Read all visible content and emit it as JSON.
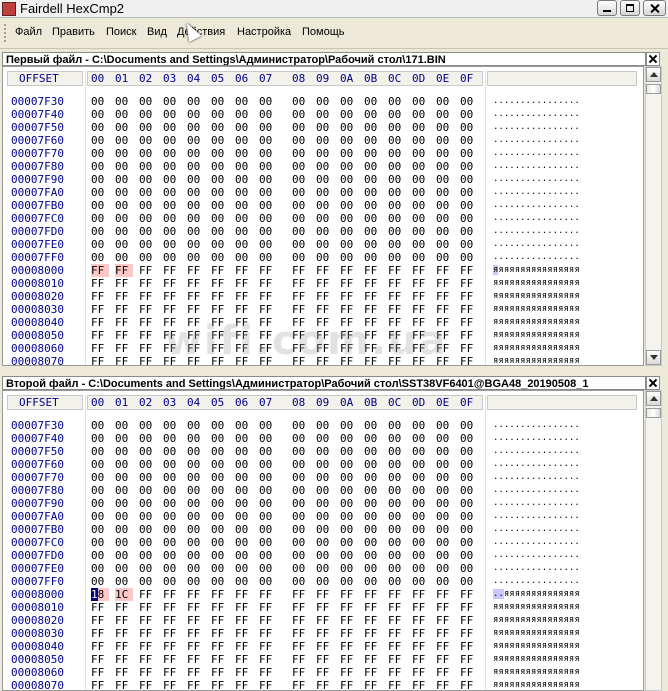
{
  "window": {
    "title": "Fairdell HexCmp2"
  },
  "menu": [
    "Файл",
    "Править",
    "Поиск",
    "Вид",
    "Действия",
    "Настройка",
    "Помощь"
  ],
  "columns": [
    "00",
    "01",
    "02",
    "03",
    "04",
    "05",
    "06",
    "07",
    "08",
    "09",
    "0A",
    "0B",
    "0C",
    "0D",
    "0E",
    "0F"
  ],
  "offset_label": "OFFSET",
  "watermark": "wifi.com.ua",
  "pane1": {
    "header": "Первый файл - C:\\Documents and Settings\\Администратор\\Рабочий стол\\171.BIN",
    "rows": [
      {
        "offset": "00007F30",
        "bytes": [
          "00",
          "00",
          "00",
          "00",
          "00",
          "00",
          "00",
          "00",
          "00",
          "00",
          "00",
          "00",
          "00",
          "00",
          "00",
          "00"
        ],
        "ascii": "................"
      },
      {
        "offset": "00007F40",
        "bytes": [
          "00",
          "00",
          "00",
          "00",
          "00",
          "00",
          "00",
          "00",
          "00",
          "00",
          "00",
          "00",
          "00",
          "00",
          "00",
          "00"
        ],
        "ascii": "................"
      },
      {
        "offset": "00007F50",
        "bytes": [
          "00",
          "00",
          "00",
          "00",
          "00",
          "00",
          "00",
          "00",
          "00",
          "00",
          "00",
          "00",
          "00",
          "00",
          "00",
          "00"
        ],
        "ascii": "................"
      },
      {
        "offset": "00007F60",
        "bytes": [
          "00",
          "00",
          "00",
          "00",
          "00",
          "00",
          "00",
          "00",
          "00",
          "00",
          "00",
          "00",
          "00",
          "00",
          "00",
          "00"
        ],
        "ascii": "................"
      },
      {
        "offset": "00007F70",
        "bytes": [
          "00",
          "00",
          "00",
          "00",
          "00",
          "00",
          "00",
          "00",
          "00",
          "00",
          "00",
          "00",
          "00",
          "00",
          "00",
          "00"
        ],
        "ascii": "................"
      },
      {
        "offset": "00007F80",
        "bytes": [
          "00",
          "00",
          "00",
          "00",
          "00",
          "00",
          "00",
          "00",
          "00",
          "00",
          "00",
          "00",
          "00",
          "00",
          "00",
          "00"
        ],
        "ascii": "................"
      },
      {
        "offset": "00007F90",
        "bytes": [
          "00",
          "00",
          "00",
          "00",
          "00",
          "00",
          "00",
          "00",
          "00",
          "00",
          "00",
          "00",
          "00",
          "00",
          "00",
          "00"
        ],
        "ascii": "................"
      },
      {
        "offset": "00007FA0",
        "bytes": [
          "00",
          "00",
          "00",
          "00",
          "00",
          "00",
          "00",
          "00",
          "00",
          "00",
          "00",
          "00",
          "00",
          "00",
          "00",
          "00"
        ],
        "ascii": "................"
      },
      {
        "offset": "00007FB0",
        "bytes": [
          "00",
          "00",
          "00",
          "00",
          "00",
          "00",
          "00",
          "00",
          "00",
          "00",
          "00",
          "00",
          "00",
          "00",
          "00",
          "00"
        ],
        "ascii": "................"
      },
      {
        "offset": "00007FC0",
        "bytes": [
          "00",
          "00",
          "00",
          "00",
          "00",
          "00",
          "00",
          "00",
          "00",
          "00",
          "00",
          "00",
          "00",
          "00",
          "00",
          "00"
        ],
        "ascii": "................"
      },
      {
        "offset": "00007FD0",
        "bytes": [
          "00",
          "00",
          "00",
          "00",
          "00",
          "00",
          "00",
          "00",
          "00",
          "00",
          "00",
          "00",
          "00",
          "00",
          "00",
          "00"
        ],
        "ascii": "................"
      },
      {
        "offset": "00007FE0",
        "bytes": [
          "00",
          "00",
          "00",
          "00",
          "00",
          "00",
          "00",
          "00",
          "00",
          "00",
          "00",
          "00",
          "00",
          "00",
          "00",
          "00"
        ],
        "ascii": "................"
      },
      {
        "offset": "00007FF0",
        "bytes": [
          "00",
          "00",
          "00",
          "00",
          "00",
          "00",
          "00",
          "00",
          "00",
          "00",
          "00",
          "00",
          "00",
          "00",
          "00",
          "00"
        ],
        "ascii": "................"
      },
      {
        "offset": "00008000",
        "bytes": [
          "FF",
          "FF",
          "FF",
          "FF",
          "FF",
          "FF",
          "FF",
          "FF",
          "FF",
          "FF",
          "FF",
          "FF",
          "FF",
          "FF",
          "FF",
          "FF"
        ],
        "ascii": "яяяяяяяяяяяяяяяя",
        "hl": [
          0,
          1
        ],
        "ahl": [
          0
        ]
      },
      {
        "offset": "00008010",
        "bytes": [
          "FF",
          "FF",
          "FF",
          "FF",
          "FF",
          "FF",
          "FF",
          "FF",
          "FF",
          "FF",
          "FF",
          "FF",
          "FF",
          "FF",
          "FF",
          "FF"
        ],
        "ascii": "яяяяяяяяяяяяяяяя"
      },
      {
        "offset": "00008020",
        "bytes": [
          "FF",
          "FF",
          "FF",
          "FF",
          "FF",
          "FF",
          "FF",
          "FF",
          "FF",
          "FF",
          "FF",
          "FF",
          "FF",
          "FF",
          "FF",
          "FF"
        ],
        "ascii": "яяяяяяяяяяяяяяяя"
      },
      {
        "offset": "00008030",
        "bytes": [
          "FF",
          "FF",
          "FF",
          "FF",
          "FF",
          "FF",
          "FF",
          "FF",
          "FF",
          "FF",
          "FF",
          "FF",
          "FF",
          "FF",
          "FF",
          "FF"
        ],
        "ascii": "яяяяяяяяяяяяяяяя"
      },
      {
        "offset": "00008040",
        "bytes": [
          "FF",
          "FF",
          "FF",
          "FF",
          "FF",
          "FF",
          "FF",
          "FF",
          "FF",
          "FF",
          "FF",
          "FF",
          "FF",
          "FF",
          "FF",
          "FF"
        ],
        "ascii": "яяяяяяяяяяяяяяяя"
      },
      {
        "offset": "00008050",
        "bytes": [
          "FF",
          "FF",
          "FF",
          "FF",
          "FF",
          "FF",
          "FF",
          "FF",
          "FF",
          "FF",
          "FF",
          "FF",
          "FF",
          "FF",
          "FF",
          "FF"
        ],
        "ascii": "яяяяяяяяяяяяяяяя"
      },
      {
        "offset": "00008060",
        "bytes": [
          "FF",
          "FF",
          "FF",
          "FF",
          "FF",
          "FF",
          "FF",
          "FF",
          "FF",
          "FF",
          "FF",
          "FF",
          "FF",
          "FF",
          "FF",
          "FF"
        ],
        "ascii": "яяяяяяяяяяяяяяяя"
      },
      {
        "offset": "00008070",
        "bytes": [
          "FF",
          "FF",
          "FF",
          "FF",
          "FF",
          "FF",
          "FF",
          "FF",
          "FF",
          "FF",
          "FF",
          "FF",
          "FF",
          "FF",
          "FF",
          "FF"
        ],
        "ascii": "яяяяяяяяяяяяяяяя"
      }
    ]
  },
  "pane2": {
    "header": "Второй файл - C:\\Documents and Settings\\Администратор\\Рабочий стол\\SST38VF6401@BGA48_20190508_1",
    "rows": [
      {
        "offset": "00007F30",
        "bytes": [
          "00",
          "00",
          "00",
          "00",
          "00",
          "00",
          "00",
          "00",
          "00",
          "00",
          "00",
          "00",
          "00",
          "00",
          "00",
          "00"
        ],
        "ascii": "................"
      },
      {
        "offset": "00007F40",
        "bytes": [
          "00",
          "00",
          "00",
          "00",
          "00",
          "00",
          "00",
          "00",
          "00",
          "00",
          "00",
          "00",
          "00",
          "00",
          "00",
          "00"
        ],
        "ascii": "................"
      },
      {
        "offset": "00007F50",
        "bytes": [
          "00",
          "00",
          "00",
          "00",
          "00",
          "00",
          "00",
          "00",
          "00",
          "00",
          "00",
          "00",
          "00",
          "00",
          "00",
          "00"
        ],
        "ascii": "................"
      },
      {
        "offset": "00007F60",
        "bytes": [
          "00",
          "00",
          "00",
          "00",
          "00",
          "00",
          "00",
          "00",
          "00",
          "00",
          "00",
          "00",
          "00",
          "00",
          "00",
          "00"
        ],
        "ascii": "................"
      },
      {
        "offset": "00007F70",
        "bytes": [
          "00",
          "00",
          "00",
          "00",
          "00",
          "00",
          "00",
          "00",
          "00",
          "00",
          "00",
          "00",
          "00",
          "00",
          "00",
          "00"
        ],
        "ascii": "................"
      },
      {
        "offset": "00007F80",
        "bytes": [
          "00",
          "00",
          "00",
          "00",
          "00",
          "00",
          "00",
          "00",
          "00",
          "00",
          "00",
          "00",
          "00",
          "00",
          "00",
          "00"
        ],
        "ascii": "................"
      },
      {
        "offset": "00007F90",
        "bytes": [
          "00",
          "00",
          "00",
          "00",
          "00",
          "00",
          "00",
          "00",
          "00",
          "00",
          "00",
          "00",
          "00",
          "00",
          "00",
          "00"
        ],
        "ascii": "................"
      },
      {
        "offset": "00007FA0",
        "bytes": [
          "00",
          "00",
          "00",
          "00",
          "00",
          "00",
          "00",
          "00",
          "00",
          "00",
          "00",
          "00",
          "00",
          "00",
          "00",
          "00"
        ],
        "ascii": "................"
      },
      {
        "offset": "00007FB0",
        "bytes": [
          "00",
          "00",
          "00",
          "00",
          "00",
          "00",
          "00",
          "00",
          "00",
          "00",
          "00",
          "00",
          "00",
          "00",
          "00",
          "00"
        ],
        "ascii": "................"
      },
      {
        "offset": "00007FC0",
        "bytes": [
          "00",
          "00",
          "00",
          "00",
          "00",
          "00",
          "00",
          "00",
          "00",
          "00",
          "00",
          "00",
          "00",
          "00",
          "00",
          "00"
        ],
        "ascii": "................"
      },
      {
        "offset": "00007FD0",
        "bytes": [
          "00",
          "00",
          "00",
          "00",
          "00",
          "00",
          "00",
          "00",
          "00",
          "00",
          "00",
          "00",
          "00",
          "00",
          "00",
          "00"
        ],
        "ascii": "................"
      },
      {
        "offset": "00007FE0",
        "bytes": [
          "00",
          "00",
          "00",
          "00",
          "00",
          "00",
          "00",
          "00",
          "00",
          "00",
          "00",
          "00",
          "00",
          "00",
          "00",
          "00"
        ],
        "ascii": "................"
      },
      {
        "offset": "00007FF0",
        "bytes": [
          "00",
          "00",
          "00",
          "00",
          "00",
          "00",
          "00",
          "00",
          "00",
          "00",
          "00",
          "00",
          "00",
          "00",
          "00",
          "00"
        ],
        "ascii": "................"
      },
      {
        "offset": "00008000",
        "bytes": [
          "18",
          "1C",
          "FF",
          "FF",
          "FF",
          "FF",
          "FF",
          "FF",
          "FF",
          "FF",
          "FF",
          "FF",
          "FF",
          "FF",
          "FF",
          "FF"
        ],
        "ascii": "..яяяяяяяяяяяяяя",
        "hl": [
          0,
          1
        ],
        "sel": 0,
        "ahl": [
          0,
          1
        ]
      },
      {
        "offset": "00008010",
        "bytes": [
          "FF",
          "FF",
          "FF",
          "FF",
          "FF",
          "FF",
          "FF",
          "FF",
          "FF",
          "FF",
          "FF",
          "FF",
          "FF",
          "FF",
          "FF",
          "FF"
        ],
        "ascii": "яяяяяяяяяяяяяяяя"
      },
      {
        "offset": "00008020",
        "bytes": [
          "FF",
          "FF",
          "FF",
          "FF",
          "FF",
          "FF",
          "FF",
          "FF",
          "FF",
          "FF",
          "FF",
          "FF",
          "FF",
          "FF",
          "FF",
          "FF"
        ],
        "ascii": "яяяяяяяяяяяяяяяя"
      },
      {
        "offset": "00008030",
        "bytes": [
          "FF",
          "FF",
          "FF",
          "FF",
          "FF",
          "FF",
          "FF",
          "FF",
          "FF",
          "FF",
          "FF",
          "FF",
          "FF",
          "FF",
          "FF",
          "FF"
        ],
        "ascii": "яяяяяяяяяяяяяяяя"
      },
      {
        "offset": "00008040",
        "bytes": [
          "FF",
          "FF",
          "FF",
          "FF",
          "FF",
          "FF",
          "FF",
          "FF",
          "FF",
          "FF",
          "FF",
          "FF",
          "FF",
          "FF",
          "FF",
          "FF"
        ],
        "ascii": "яяяяяяяяяяяяяяяя"
      },
      {
        "offset": "00008050",
        "bytes": [
          "FF",
          "FF",
          "FF",
          "FF",
          "FF",
          "FF",
          "FF",
          "FF",
          "FF",
          "FF",
          "FF",
          "FF",
          "FF",
          "FF",
          "FF",
          "FF"
        ],
        "ascii": "яяяяяяяяяяяяяяяя"
      },
      {
        "offset": "00008060",
        "bytes": [
          "FF",
          "FF",
          "FF",
          "FF",
          "FF",
          "FF",
          "FF",
          "FF",
          "FF",
          "FF",
          "FF",
          "FF",
          "FF",
          "FF",
          "FF",
          "FF"
        ],
        "ascii": "яяяяяяяяяяяяяяяя"
      },
      {
        "offset": "00008070",
        "bytes": [
          "FF",
          "FF",
          "FF",
          "FF",
          "FF",
          "FF",
          "FF",
          "FF",
          "FF",
          "FF",
          "FF",
          "FF",
          "FF",
          "FF",
          "FF",
          "FF"
        ],
        "ascii": "яяяяяяяяяяяяяяяя"
      }
    ]
  }
}
